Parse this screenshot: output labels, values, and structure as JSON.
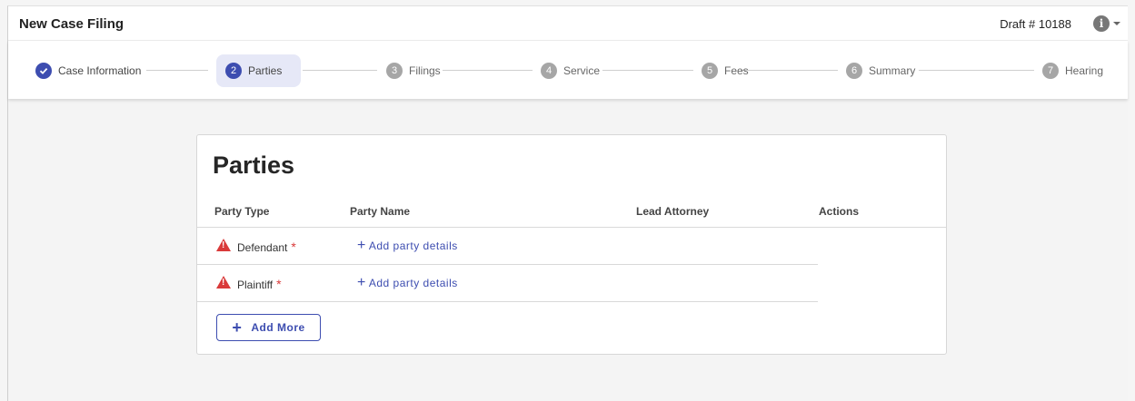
{
  "header": {
    "title": "New Case Filing",
    "draft_label": "Draft # 10188",
    "info_icon": "info-icon"
  },
  "steps": [
    {
      "num": "",
      "label": "Case Information",
      "state": "complete"
    },
    {
      "num": "2",
      "label": "Parties",
      "state": "active"
    },
    {
      "num": "3",
      "label": "Filings",
      "state": "pending"
    },
    {
      "num": "4",
      "label": "Service",
      "state": "pending"
    },
    {
      "num": "5",
      "label": "Fees",
      "state": "pending"
    },
    {
      "num": "6",
      "label": "Summary",
      "state": "pending"
    },
    {
      "num": "7",
      "label": "Hearing",
      "state": "pending"
    }
  ],
  "parties": {
    "title": "Parties",
    "columns": [
      "Party Type",
      "Party Name",
      "Lead Attorney",
      "Actions"
    ],
    "rows": [
      {
        "type": "Defendant",
        "required": "*",
        "action": "Add party details"
      },
      {
        "type": "Plaintiff",
        "required": "*",
        "action": "Add party details"
      }
    ],
    "add_more_label": "Add More"
  },
  "colors": {
    "accent": "#3d4db0",
    "warning": "#d93a3a",
    "active_step_bg": "#e6e8f7"
  }
}
